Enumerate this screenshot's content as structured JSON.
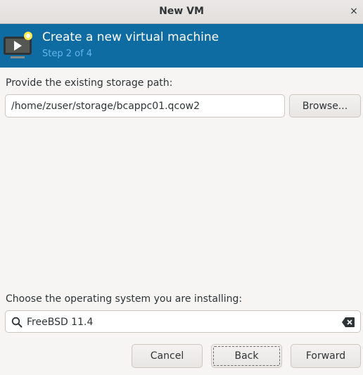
{
  "window": {
    "title": "New VM",
    "close_glyph": "×"
  },
  "header": {
    "icon": "vm-screen-icon",
    "title": "Create a new virtual machine",
    "step": "Step 2 of 4"
  },
  "storage": {
    "label": "Provide the existing storage path:",
    "path_value": "/home/zuser/storage/bcappc01.qcow2",
    "browse_label": "Browse..."
  },
  "os": {
    "label": "Choose the operating system you are installing:",
    "search_value": "FreeBSD 11.4",
    "search_icon": "search-icon",
    "clear_icon": "clear-text-icon"
  },
  "buttons": {
    "cancel": "Cancel",
    "back": "Back",
    "forward": "Forward"
  },
  "colors": {
    "banner": "#0e6ca3",
    "step_text": "#65b4ea"
  }
}
